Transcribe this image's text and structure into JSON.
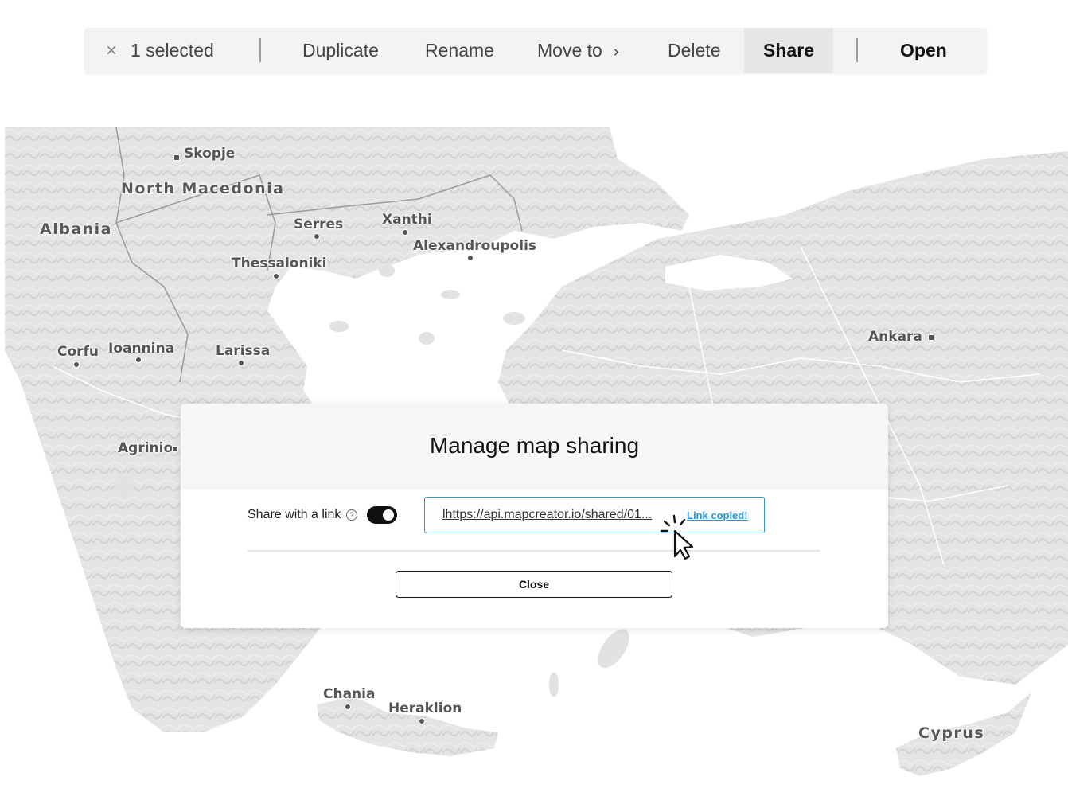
{
  "toolbar": {
    "close_glyph": "×",
    "selection_count": "1 selected",
    "duplicate": "Duplicate",
    "rename": "Rename",
    "move_to": "Move to",
    "move_chevron": "›",
    "delete": "Delete",
    "share": "Share",
    "open": "Open"
  },
  "map": {
    "countries": [
      "Albania",
      "North Macedonia",
      "Cyprus"
    ],
    "cities": [
      "Skopje",
      "Serres",
      "Xanthi",
      "Alexandroupolis",
      "Thessaloniki",
      "Corfu",
      "Ioannina",
      "Larissa",
      "Agrinio",
      "Ankara",
      "Chania",
      "Heraklion"
    ]
  },
  "dialog": {
    "title": "Manage map sharing",
    "share_label": "Share with a link",
    "help_glyph": "?",
    "toggle_on": true,
    "link": "lhttps://api.mapcreator.io/shared/01...",
    "link_status": "Link copied!",
    "close_label": "Close"
  },
  "icons": [
    "close-icon",
    "chevron-right-icon",
    "help-icon",
    "toggle-switch",
    "pointer-cursor-icon"
  ],
  "colors": {
    "accent": "#2b95d6",
    "toggle": "#111111",
    "toolbar_bg": "#f4f3f3",
    "active_tab_bg": "#e8e6e5"
  }
}
